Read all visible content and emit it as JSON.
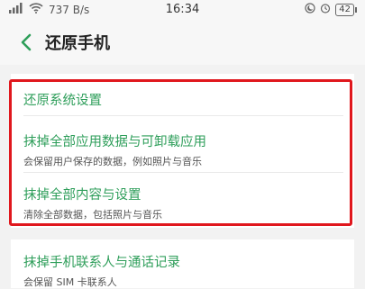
{
  "status": {
    "speed": "737 B/s",
    "time": "16:34",
    "battery": "42"
  },
  "header": {
    "title": "还原手机"
  },
  "options": [
    {
      "title": "还原系统设置",
      "subtitle": ""
    },
    {
      "title": "抹掉全部应用数据与可卸载应用",
      "subtitle": "会保留用户保存的数据，例如照片与音乐"
    },
    {
      "title": "抹掉全部内容与设置",
      "subtitle": "清除全部数据，包括照片与音乐"
    },
    {
      "title": "抹掉手机联系人与通话记录",
      "subtitle": "会保留 SIM 卡联系人"
    }
  ],
  "colors": {
    "accent": "#2e9e5a",
    "highlight": "#e0171d"
  }
}
